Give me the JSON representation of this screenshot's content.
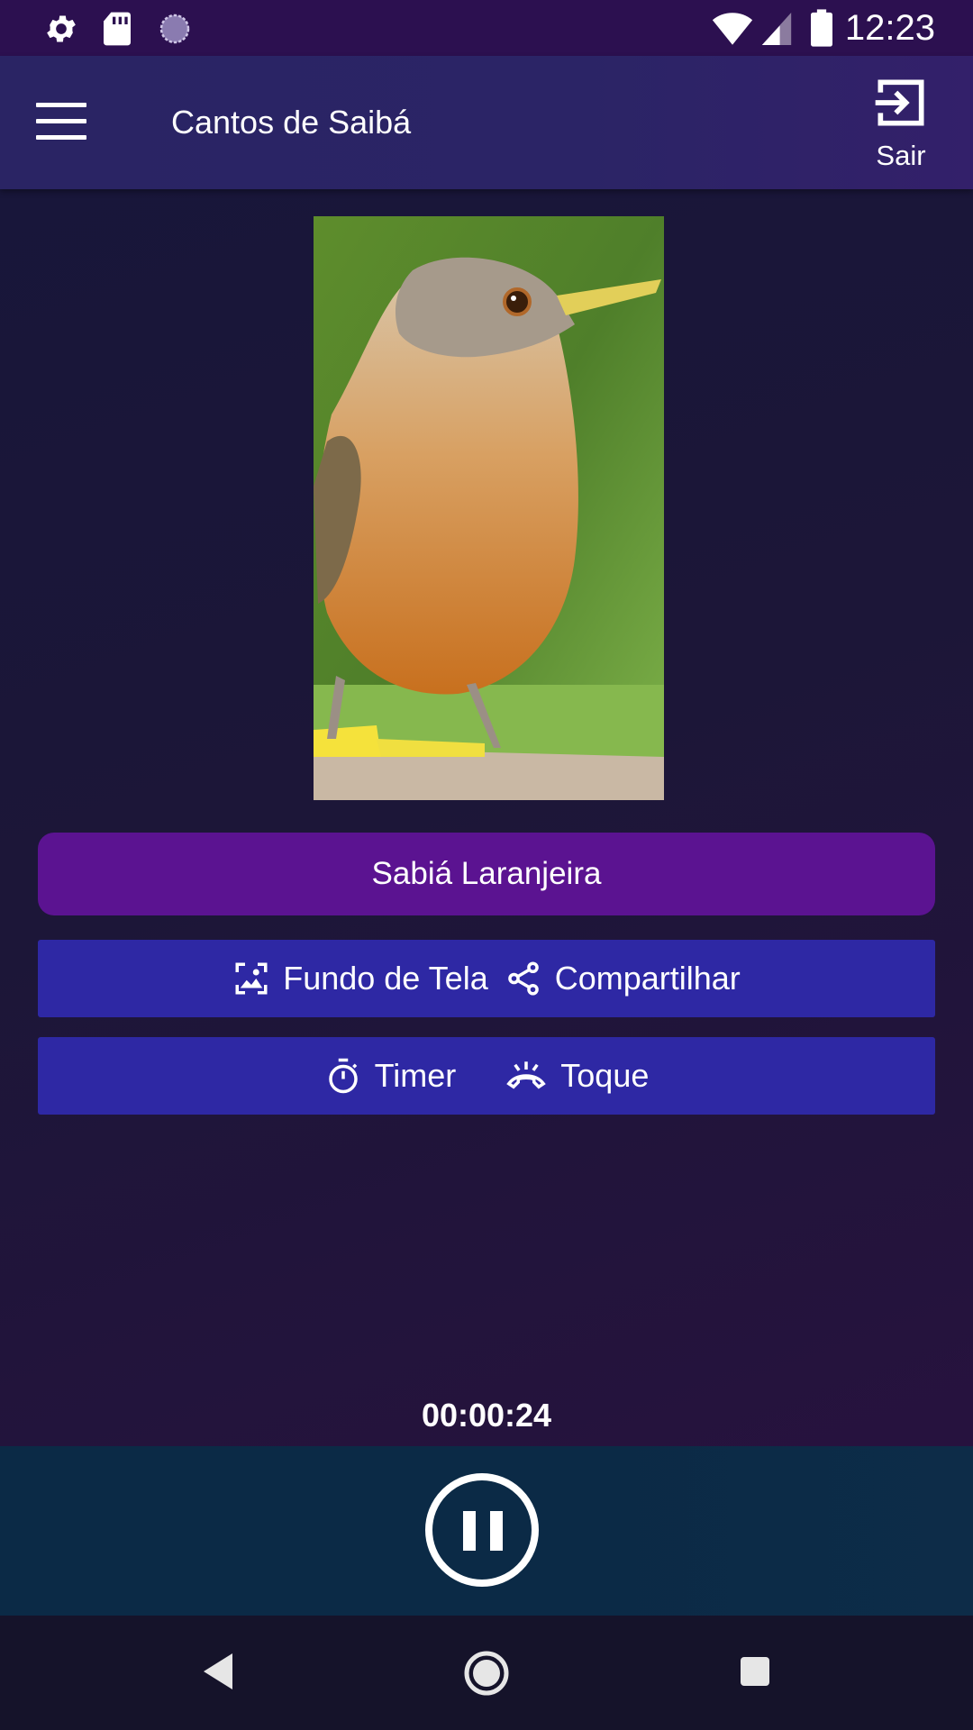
{
  "status_bar": {
    "time": "12:23",
    "left_icons": [
      "gear-icon",
      "sd-card-icon",
      "loading-circle-icon"
    ],
    "right_icons": [
      "wifi-icon",
      "signal-icon",
      "battery-icon"
    ]
  },
  "app_bar": {
    "title": "Cantos de Saibá",
    "exit_label": "Sair"
  },
  "bird": {
    "name_button": "Sabiá Laranjeira"
  },
  "actions": {
    "wallpaper_label": "Fundo de Tela",
    "share_label": "Compartilhar",
    "timer_label": "Timer",
    "ringtone_label": "Toque"
  },
  "player": {
    "elapsed": "00:00:24",
    "state_icon": "pause-icon"
  },
  "colors": {
    "app_bar": "#2a2464",
    "name_button": "#5b1391",
    "action_rows": "#2e28a4",
    "player_bar": "#0b2a46"
  }
}
